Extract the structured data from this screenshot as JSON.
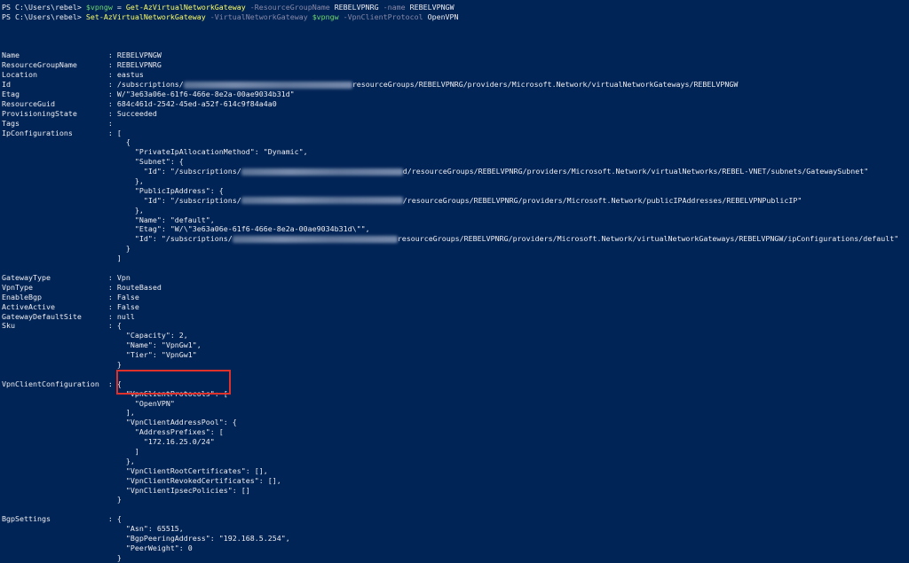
{
  "colors": {
    "background": "#012456",
    "cmdlet": "#ffff66",
    "parameter": "#8a8aa8",
    "variable": "#6fd86f",
    "highlight": "#e0302a"
  },
  "commands": [
    {
      "prompt": "PS C:\\Users\\rebel> ",
      "var_assign": "$vpngw",
      "eq": " = ",
      "cmdlet": "Get-AzVirtualNetworkGateway",
      "p1": " -ResourceGroupName ",
      "a1": "REBELVPNRG",
      "p2": " -name ",
      "a2": "REBELVPNGW"
    },
    {
      "prompt": "PS C:\\Users\\rebel> ",
      "cmdlet": "Set-AzVirtualNetworkGateway",
      "p1": " -VirtualNetworkGateway ",
      "var": "$vpngw",
      "p2": " -VpnClientProtocol ",
      "a2": "OpenVPN"
    }
  ],
  "output": {
    "name": "Name                    : REBELVPNGW",
    "rg": "ResourceGroupName       : REBELVPNRG",
    "location": "Location                : eastus",
    "id_pre": "Id                      : /subscriptions/",
    "id_post": "resourceGroups/REBELVPNRG/providers/Microsoft.Network/virtualNetworkGateways/REBELVPNGW",
    "etag": "Etag                    : W/\"3e63a06e-61f6-466e-8e2a-00ae9034b31d\"",
    "guid": "ResourceGuid            : 684c461d-2542-45ed-a52f-614c9f84a4a0",
    "prov": "ProvisioningState       : Succeeded",
    "tags": "Tags                    :",
    "ipconf": "IpConfigurations        : [",
    "ip1": "                            {",
    "ip2": "                              \"PrivateIpAllocationMethod\": \"Dynamic\",",
    "ip3": "                              \"Subnet\": {",
    "ip4_pre": "                                \"Id\": \"/subscriptions/",
    "ip4_post": "d/resourceGroups/REBELVPNRG/providers/Microsoft.Network/virtualNetworks/REBEL-VNET/subnets/GatewaySubnet\"",
    "ip5": "                              },",
    "ip6": "                              \"PublicIpAddress\": {",
    "ip7_pre": "                                \"Id\": \"/subscriptions/",
    "ip7_post": "/resourceGroups/REBELVPNRG/providers/Microsoft.Network/publicIPAddresses/REBELVPNPublicIP\"",
    "ip8": "                              },",
    "ip9": "                              \"Name\": \"default\",",
    "ip10": "                              \"Etag\": \"W/\\\"3e63a06e-61f6-466e-8e2a-00ae9034b31d\\\"\",",
    "ip11_pre": "                              \"Id\": \"/subscriptions/",
    "ip11_post": "resourceGroups/REBELVPNRG/providers/Microsoft.Network/virtualNetworkGateways/REBELVPNGW/ipConfigurations/default\"",
    "ip12": "                            }",
    "ip13": "                          ]",
    "gwtype": "GatewayType             : Vpn",
    "vpntype": "VpnType                 : RouteBased",
    "bgp": "EnableBgp               : False",
    "aa": "ActiveActive            : False",
    "gds": "GatewayDefaultSite      : null",
    "sku": "Sku                     : {",
    "sku1": "                            \"Capacity\": 2,",
    "sku2": "                            \"Name\": \"VpnGw1\",",
    "sku3": "                            \"Tier\": \"VpnGw1\"",
    "sku4": "                          }",
    "vcc": "VpnClientConfiguration  : {",
    "vcc1": "                            \"VpnClientProtocols\": [",
    "vcc2": "                              \"OpenVPN\"",
    "vcc3": "                            ],",
    "vcc4": "                            \"VpnClientAddressPool\": {",
    "vcc5": "                              \"AddressPrefixes\": [",
    "vcc6": "                                \"172.16.25.0/24\"",
    "vcc7": "                              ]",
    "vcc8": "                            },",
    "vcc9": "                            \"VpnClientRootCertificates\": [],",
    "vcc10": "                            \"VpnClientRevokedCertificates\": [],",
    "vcc11": "                            \"VpnClientIpsecPolicies\": []",
    "vcc12": "                          }",
    "bgps": "BgpSettings             : {",
    "bgp1": "                            \"Asn\": 65515,",
    "bgp2": "                            \"BgpPeeringAddress\": \"192.168.5.254\",",
    "bgp3": "                            \"PeerWeight\": 0",
    "bgp4": "                          }"
  }
}
